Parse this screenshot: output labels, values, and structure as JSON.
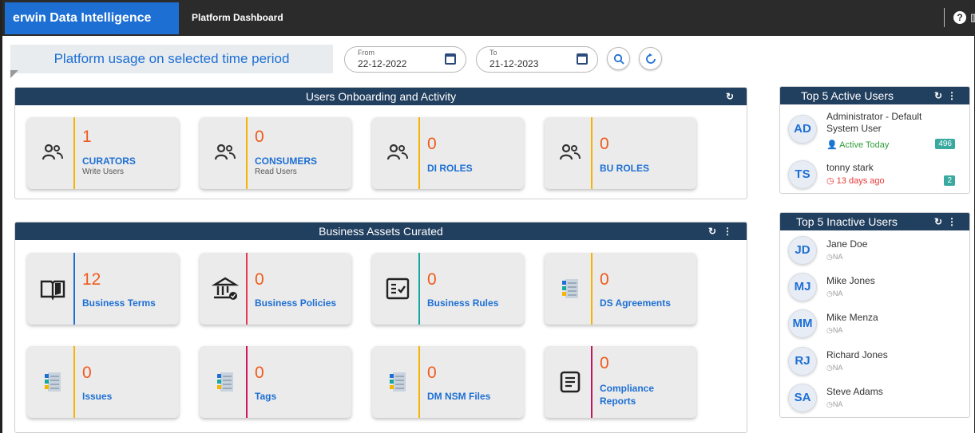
{
  "app": {
    "brand": "erwin Data Intelligence",
    "page": "Platform Dashboard"
  },
  "filter": {
    "label": "Platform usage on selected time period",
    "from_caption": "From",
    "from_value": "22-12-2022",
    "to_caption": "To",
    "to_value": "21-12-2023"
  },
  "onboarding": {
    "title": "Users Onboarding and Activity",
    "cards": [
      {
        "count": "1",
        "label": "CURATORS",
        "sub": "Write Users",
        "accent": "#f5b400"
      },
      {
        "count": "0",
        "label": "CONSUMERS",
        "sub": "Read Users",
        "accent": "#f5b400"
      },
      {
        "count": "0",
        "label": "DI ROLES",
        "sub": "",
        "accent": "#f5b400"
      },
      {
        "count": "0",
        "label": "BU ROLES",
        "sub": "",
        "accent": "#f5b400"
      }
    ]
  },
  "assets": {
    "title": "Business Assets Curated",
    "cards": [
      {
        "count": "12",
        "label": "Business Terms",
        "icon": "book-icon",
        "accent": "#1d6fd4"
      },
      {
        "count": "0",
        "label": "Business Policies",
        "icon": "bank-icon",
        "accent": "#e63950"
      },
      {
        "count": "0",
        "label": "Business Rules",
        "icon": "checklist-icon",
        "accent": "#14a8a0"
      },
      {
        "count": "0",
        "label": "DS Agreements",
        "icon": "notebook-icon",
        "accent": "#f5b400"
      },
      {
        "count": "0",
        "label": "Issues",
        "icon": "notebook-icon",
        "accent": "#f5b400"
      },
      {
        "count": "0",
        "label": "Tags",
        "icon": "notebook-icon",
        "accent": "#d4145a"
      },
      {
        "count": "0",
        "label": "DM NSM Files",
        "icon": "notebook-icon",
        "accent": "#f5b400"
      },
      {
        "count": "0",
        "label": "Compliance Reports",
        "icon": "document-icon",
        "accent": "#c2185b"
      }
    ]
  },
  "active_users": {
    "title": "Top 5 Active Users",
    "users": [
      {
        "initials": "AD",
        "name": "Administrator - Default System User",
        "status": "Active Today",
        "count": "496"
      },
      {
        "initials": "TS",
        "name": "tonny stark",
        "status": "13 days ago",
        "count": "2"
      }
    ]
  },
  "inactive_users": {
    "title": "Top 5 Inactive Users",
    "users": [
      {
        "initials": "JD",
        "name": "Jane Doe",
        "status": "NA"
      },
      {
        "initials": "MJ",
        "name": "Mike Jones",
        "status": "NA"
      },
      {
        "initials": "MM",
        "name": "Mike Menza",
        "status": "NA"
      },
      {
        "initials": "RJ",
        "name": "Richard Jones",
        "status": "NA"
      },
      {
        "initials": "SA",
        "name": "Steve Adams",
        "status": "NA"
      }
    ]
  },
  "colors": {
    "count": "#f05a1c",
    "label": "#1d6fd4",
    "panel_head": "#213f5f",
    "brand": "#1d6fd4"
  }
}
